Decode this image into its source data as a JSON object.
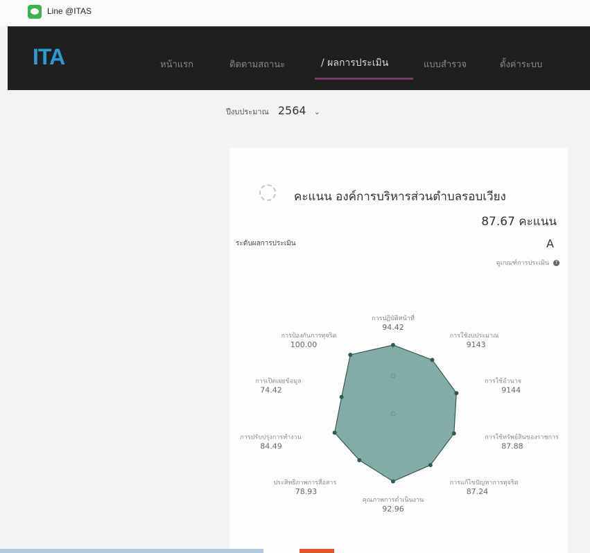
{
  "topbar": {
    "line_text": "Line @ITAS"
  },
  "nav": {
    "brand": "ITA",
    "items": [
      {
        "label": "หน้าแรก"
      },
      {
        "label": "ติดตามสถานะ"
      },
      {
        "label": "/ ผลการประเมิน"
      },
      {
        "label": "แบบสำรวจ"
      },
      {
        "label": "ตั้งค่าระบบ"
      }
    ]
  },
  "year": {
    "label": "ปีงบประมาณ",
    "value": "2564"
  },
  "score": {
    "title": "คะแนน องค์การบริหารส่วนตำบลรอบเวียง",
    "value": "87.67 คะแนน",
    "level_label": "ระดับผลการประเมิน",
    "level_grade": "A",
    "criteria_link": "ดูเกณฑ์การประเมิน"
  },
  "colors": {
    "radar_fill": "#6f9e97",
    "radar_stroke": "#2f5c52",
    "brand": "#2b9bd8",
    "nav_bg": "#1f1f1f"
  },
  "chart_data": {
    "type": "radar",
    "categories": [
      "การปฏิบัติหน้าที่",
      "การใช้งบประมาณ",
      "การใช้อำนาจ",
      "การใช้ทรัพย์สินของราชการ",
      "การแก้ไขปัญหาการทุจริต",
      "คุณภาพการดำเนินงาน",
      "ประสิทธิภาพการสื่อสาร",
      "การปรับปรุงการทำงาน",
      "การเปิดเผยข้อมูล",
      "การป้องกันการทุจริต"
    ],
    "values": [
      94.42,
      91.43,
      91.44,
      87.88,
      87.24,
      92.96,
      78.93,
      84.49,
      74.42,
      100.0
    ],
    "value_labels": [
      "94.42",
      "9143",
      "9144",
      "87.88",
      "87.24",
      "92.96",
      "78.93",
      "84.49",
      "74.42",
      "100.00"
    ],
    "rmax": 100
  }
}
